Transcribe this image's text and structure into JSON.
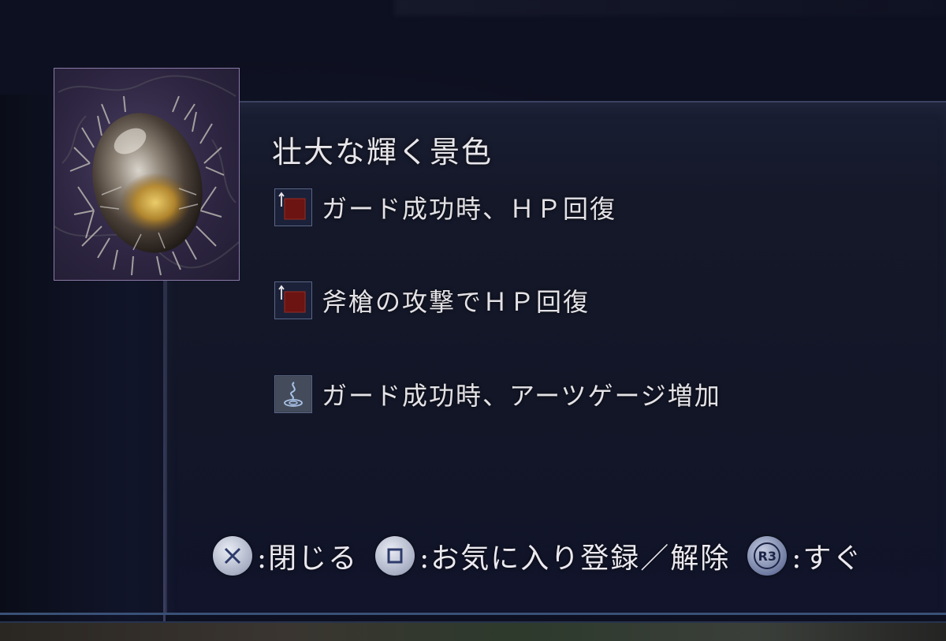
{
  "item": {
    "title": "壮大な輝く景色",
    "icon": "glowing-stone-in-branches-icon"
  },
  "effects": [
    {
      "icon": "red-square-upgrade-icon",
      "text": "ガード成功時、ＨＰ回復"
    },
    {
      "icon": "red-square-upgrade-icon",
      "text": "斧槍の攻撃でＨＰ回復"
    },
    {
      "icon": "blue-swirl-icon",
      "text": "ガード成功時、アーツゲージ増加"
    }
  ],
  "controls": [
    {
      "button": "cross-button-icon",
      "label": ":閉じる"
    },
    {
      "button": "square-button-icon",
      "label": ":お気に入り登録／解除"
    },
    {
      "button": "r3-button-icon",
      "button_text": "R3",
      "label": ":すぐ"
    }
  ],
  "colors": {
    "background": "#0d1020",
    "panel": "#141829",
    "frame_border": "#8a7aa6",
    "text": "#e8e6ea",
    "effect_red": "#6b1412",
    "footer_line": "#3a5076"
  }
}
